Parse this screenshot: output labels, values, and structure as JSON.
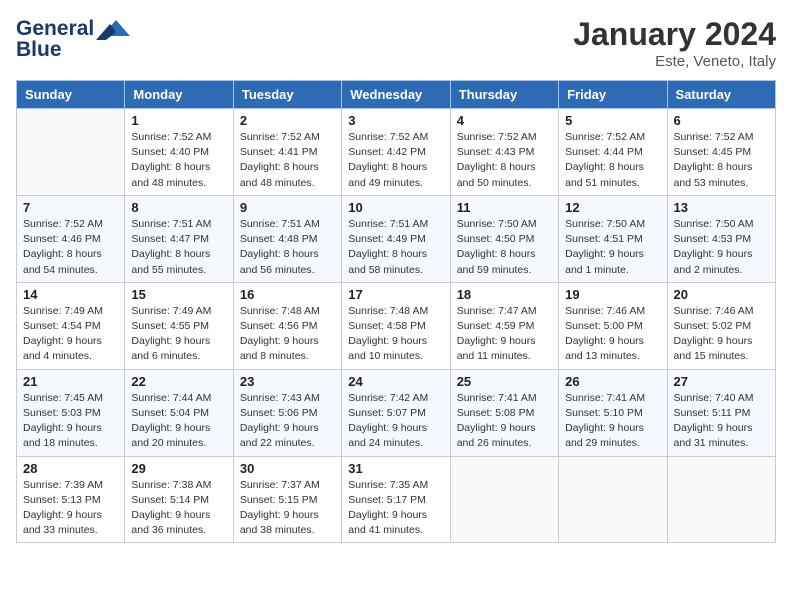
{
  "header": {
    "logo_line1": "General",
    "logo_line2": "Blue",
    "month_year": "January 2024",
    "location": "Este, Veneto, Italy"
  },
  "days_of_week": [
    "Sunday",
    "Monday",
    "Tuesday",
    "Wednesday",
    "Thursday",
    "Friday",
    "Saturday"
  ],
  "weeks": [
    [
      {
        "day": "",
        "info": ""
      },
      {
        "day": "1",
        "info": "Sunrise: 7:52 AM\nSunset: 4:40 PM\nDaylight: 8 hours\nand 48 minutes."
      },
      {
        "day": "2",
        "info": "Sunrise: 7:52 AM\nSunset: 4:41 PM\nDaylight: 8 hours\nand 48 minutes."
      },
      {
        "day": "3",
        "info": "Sunrise: 7:52 AM\nSunset: 4:42 PM\nDaylight: 8 hours\nand 49 minutes."
      },
      {
        "day": "4",
        "info": "Sunrise: 7:52 AM\nSunset: 4:43 PM\nDaylight: 8 hours\nand 50 minutes."
      },
      {
        "day": "5",
        "info": "Sunrise: 7:52 AM\nSunset: 4:44 PM\nDaylight: 8 hours\nand 51 minutes."
      },
      {
        "day": "6",
        "info": "Sunrise: 7:52 AM\nSunset: 4:45 PM\nDaylight: 8 hours\nand 53 minutes."
      }
    ],
    [
      {
        "day": "7",
        "info": "Sunrise: 7:52 AM\nSunset: 4:46 PM\nDaylight: 8 hours\nand 54 minutes."
      },
      {
        "day": "8",
        "info": "Sunrise: 7:51 AM\nSunset: 4:47 PM\nDaylight: 8 hours\nand 55 minutes."
      },
      {
        "day": "9",
        "info": "Sunrise: 7:51 AM\nSunset: 4:48 PM\nDaylight: 8 hours\nand 56 minutes."
      },
      {
        "day": "10",
        "info": "Sunrise: 7:51 AM\nSunset: 4:49 PM\nDaylight: 8 hours\nand 58 minutes."
      },
      {
        "day": "11",
        "info": "Sunrise: 7:50 AM\nSunset: 4:50 PM\nDaylight: 8 hours\nand 59 minutes."
      },
      {
        "day": "12",
        "info": "Sunrise: 7:50 AM\nSunset: 4:51 PM\nDaylight: 9 hours\nand 1 minute."
      },
      {
        "day": "13",
        "info": "Sunrise: 7:50 AM\nSunset: 4:53 PM\nDaylight: 9 hours\nand 2 minutes."
      }
    ],
    [
      {
        "day": "14",
        "info": "Sunrise: 7:49 AM\nSunset: 4:54 PM\nDaylight: 9 hours\nand 4 minutes."
      },
      {
        "day": "15",
        "info": "Sunrise: 7:49 AM\nSunset: 4:55 PM\nDaylight: 9 hours\nand 6 minutes."
      },
      {
        "day": "16",
        "info": "Sunrise: 7:48 AM\nSunset: 4:56 PM\nDaylight: 9 hours\nand 8 minutes."
      },
      {
        "day": "17",
        "info": "Sunrise: 7:48 AM\nSunset: 4:58 PM\nDaylight: 9 hours\nand 10 minutes."
      },
      {
        "day": "18",
        "info": "Sunrise: 7:47 AM\nSunset: 4:59 PM\nDaylight: 9 hours\nand 11 minutes."
      },
      {
        "day": "19",
        "info": "Sunrise: 7:46 AM\nSunset: 5:00 PM\nDaylight: 9 hours\nand 13 minutes."
      },
      {
        "day": "20",
        "info": "Sunrise: 7:46 AM\nSunset: 5:02 PM\nDaylight: 9 hours\nand 15 minutes."
      }
    ],
    [
      {
        "day": "21",
        "info": "Sunrise: 7:45 AM\nSunset: 5:03 PM\nDaylight: 9 hours\nand 18 minutes."
      },
      {
        "day": "22",
        "info": "Sunrise: 7:44 AM\nSunset: 5:04 PM\nDaylight: 9 hours\nand 20 minutes."
      },
      {
        "day": "23",
        "info": "Sunrise: 7:43 AM\nSunset: 5:06 PM\nDaylight: 9 hours\nand 22 minutes."
      },
      {
        "day": "24",
        "info": "Sunrise: 7:42 AM\nSunset: 5:07 PM\nDaylight: 9 hours\nand 24 minutes."
      },
      {
        "day": "25",
        "info": "Sunrise: 7:41 AM\nSunset: 5:08 PM\nDaylight: 9 hours\nand 26 minutes."
      },
      {
        "day": "26",
        "info": "Sunrise: 7:41 AM\nSunset: 5:10 PM\nDaylight: 9 hours\nand 29 minutes."
      },
      {
        "day": "27",
        "info": "Sunrise: 7:40 AM\nSunset: 5:11 PM\nDaylight: 9 hours\nand 31 minutes."
      }
    ],
    [
      {
        "day": "28",
        "info": "Sunrise: 7:39 AM\nSunset: 5:13 PM\nDaylight: 9 hours\nand 33 minutes."
      },
      {
        "day": "29",
        "info": "Sunrise: 7:38 AM\nSunset: 5:14 PM\nDaylight: 9 hours\nand 36 minutes."
      },
      {
        "day": "30",
        "info": "Sunrise: 7:37 AM\nSunset: 5:15 PM\nDaylight: 9 hours\nand 38 minutes."
      },
      {
        "day": "31",
        "info": "Sunrise: 7:35 AM\nSunset: 5:17 PM\nDaylight: 9 hours\nand 41 minutes."
      },
      {
        "day": "",
        "info": ""
      },
      {
        "day": "",
        "info": ""
      },
      {
        "day": "",
        "info": ""
      }
    ]
  ]
}
